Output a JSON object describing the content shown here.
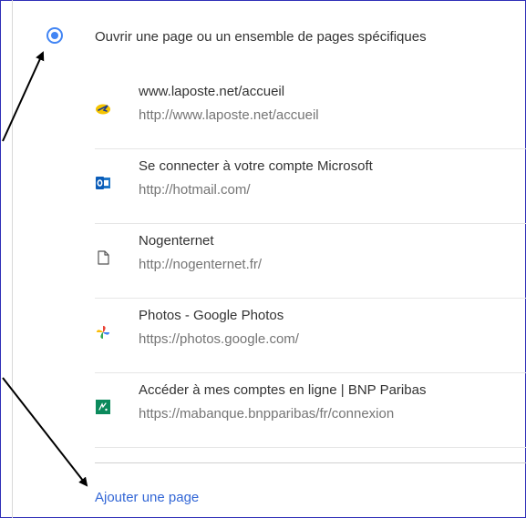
{
  "startup": {
    "option_label": "Ouvrir une page ou un ensemble de pages spécifiques",
    "pages": [
      {
        "title": "www.laposte.net/accueil",
        "url": "http://www.laposte.net/accueil",
        "icon": "laposte-icon"
      },
      {
        "title": "Se connecter à votre compte Microsoft",
        "url": "http://hotmail.com/",
        "icon": "outlook-icon"
      },
      {
        "title": "Nogenternet",
        "url": "http://nogenternet.fr/",
        "icon": "page-icon"
      },
      {
        "title": "Photos - Google Photos",
        "url": "https://photos.google.com/",
        "icon": "google-photos-icon"
      },
      {
        "title": "Accéder à mes comptes en ligne | BNP Paribas",
        "url": "https://mabanque.bnpparibas/fr/connexion",
        "icon": "bnp-paribas-icon"
      }
    ],
    "add_page_label": "Ajouter une page"
  },
  "colors": {
    "accent": "#4285f4",
    "link": "#3367d6",
    "frame_border": "#2f2fb8",
    "annotation_arrow": "#000000"
  }
}
